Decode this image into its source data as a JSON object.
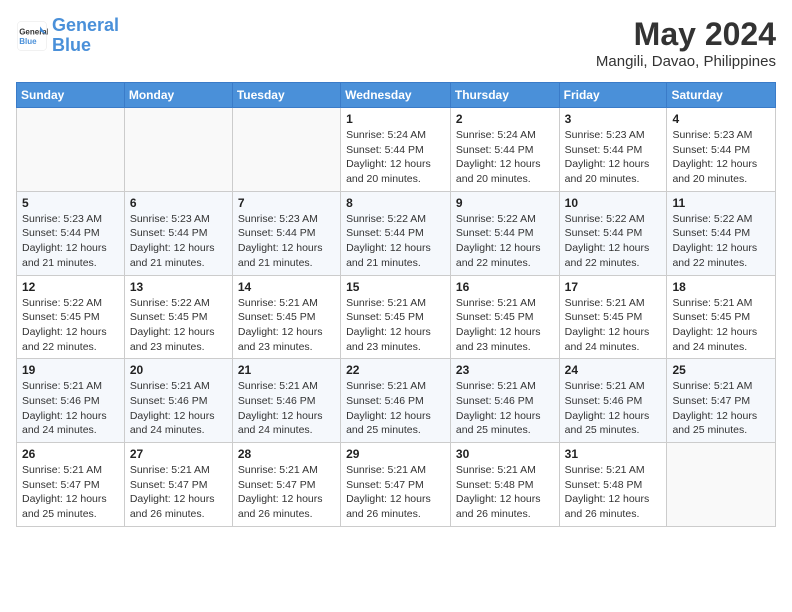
{
  "header": {
    "logo_line1": "General",
    "logo_line2": "Blue",
    "month": "May 2024",
    "location": "Mangili, Davao, Philippines"
  },
  "days_of_week": [
    "Sunday",
    "Monday",
    "Tuesday",
    "Wednesday",
    "Thursday",
    "Friday",
    "Saturday"
  ],
  "weeks": [
    [
      {
        "day": "",
        "info": ""
      },
      {
        "day": "",
        "info": ""
      },
      {
        "day": "",
        "info": ""
      },
      {
        "day": "1",
        "info": "Sunrise: 5:24 AM\nSunset: 5:44 PM\nDaylight: 12 hours and 20 minutes."
      },
      {
        "day": "2",
        "info": "Sunrise: 5:24 AM\nSunset: 5:44 PM\nDaylight: 12 hours and 20 minutes."
      },
      {
        "day": "3",
        "info": "Sunrise: 5:23 AM\nSunset: 5:44 PM\nDaylight: 12 hours and 20 minutes."
      },
      {
        "day": "4",
        "info": "Sunrise: 5:23 AM\nSunset: 5:44 PM\nDaylight: 12 hours and 20 minutes."
      }
    ],
    [
      {
        "day": "5",
        "info": "Sunrise: 5:23 AM\nSunset: 5:44 PM\nDaylight: 12 hours and 21 minutes."
      },
      {
        "day": "6",
        "info": "Sunrise: 5:23 AM\nSunset: 5:44 PM\nDaylight: 12 hours and 21 minutes."
      },
      {
        "day": "7",
        "info": "Sunrise: 5:23 AM\nSunset: 5:44 PM\nDaylight: 12 hours and 21 minutes."
      },
      {
        "day": "8",
        "info": "Sunrise: 5:22 AM\nSunset: 5:44 PM\nDaylight: 12 hours and 21 minutes."
      },
      {
        "day": "9",
        "info": "Sunrise: 5:22 AM\nSunset: 5:44 PM\nDaylight: 12 hours and 22 minutes."
      },
      {
        "day": "10",
        "info": "Sunrise: 5:22 AM\nSunset: 5:44 PM\nDaylight: 12 hours and 22 minutes."
      },
      {
        "day": "11",
        "info": "Sunrise: 5:22 AM\nSunset: 5:44 PM\nDaylight: 12 hours and 22 minutes."
      }
    ],
    [
      {
        "day": "12",
        "info": "Sunrise: 5:22 AM\nSunset: 5:45 PM\nDaylight: 12 hours and 22 minutes."
      },
      {
        "day": "13",
        "info": "Sunrise: 5:22 AM\nSunset: 5:45 PM\nDaylight: 12 hours and 23 minutes."
      },
      {
        "day": "14",
        "info": "Sunrise: 5:21 AM\nSunset: 5:45 PM\nDaylight: 12 hours and 23 minutes."
      },
      {
        "day": "15",
        "info": "Sunrise: 5:21 AM\nSunset: 5:45 PM\nDaylight: 12 hours and 23 minutes."
      },
      {
        "day": "16",
        "info": "Sunrise: 5:21 AM\nSunset: 5:45 PM\nDaylight: 12 hours and 23 minutes."
      },
      {
        "day": "17",
        "info": "Sunrise: 5:21 AM\nSunset: 5:45 PM\nDaylight: 12 hours and 24 minutes."
      },
      {
        "day": "18",
        "info": "Sunrise: 5:21 AM\nSunset: 5:45 PM\nDaylight: 12 hours and 24 minutes."
      }
    ],
    [
      {
        "day": "19",
        "info": "Sunrise: 5:21 AM\nSunset: 5:46 PM\nDaylight: 12 hours and 24 minutes."
      },
      {
        "day": "20",
        "info": "Sunrise: 5:21 AM\nSunset: 5:46 PM\nDaylight: 12 hours and 24 minutes."
      },
      {
        "day": "21",
        "info": "Sunrise: 5:21 AM\nSunset: 5:46 PM\nDaylight: 12 hours and 24 minutes."
      },
      {
        "day": "22",
        "info": "Sunrise: 5:21 AM\nSunset: 5:46 PM\nDaylight: 12 hours and 25 minutes."
      },
      {
        "day": "23",
        "info": "Sunrise: 5:21 AM\nSunset: 5:46 PM\nDaylight: 12 hours and 25 minutes."
      },
      {
        "day": "24",
        "info": "Sunrise: 5:21 AM\nSunset: 5:46 PM\nDaylight: 12 hours and 25 minutes."
      },
      {
        "day": "25",
        "info": "Sunrise: 5:21 AM\nSunset: 5:47 PM\nDaylight: 12 hours and 25 minutes."
      }
    ],
    [
      {
        "day": "26",
        "info": "Sunrise: 5:21 AM\nSunset: 5:47 PM\nDaylight: 12 hours and 25 minutes."
      },
      {
        "day": "27",
        "info": "Sunrise: 5:21 AM\nSunset: 5:47 PM\nDaylight: 12 hours and 26 minutes."
      },
      {
        "day": "28",
        "info": "Sunrise: 5:21 AM\nSunset: 5:47 PM\nDaylight: 12 hours and 26 minutes."
      },
      {
        "day": "29",
        "info": "Sunrise: 5:21 AM\nSunset: 5:47 PM\nDaylight: 12 hours and 26 minutes."
      },
      {
        "day": "30",
        "info": "Sunrise: 5:21 AM\nSunset: 5:48 PM\nDaylight: 12 hours and 26 minutes."
      },
      {
        "day": "31",
        "info": "Sunrise: 5:21 AM\nSunset: 5:48 PM\nDaylight: 12 hours and 26 minutes."
      },
      {
        "day": "",
        "info": ""
      }
    ]
  ]
}
